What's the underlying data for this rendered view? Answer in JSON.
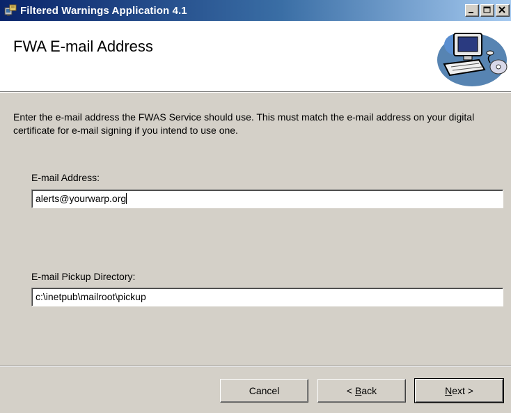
{
  "window": {
    "title": "Filtered Warnings Application 4.1",
    "controls": [
      "minimize-icon",
      "maximize-icon",
      "close-icon"
    ]
  },
  "header": {
    "title": "FWA E-mail Address",
    "art_icon": "computer-icon"
  },
  "instructions": "Enter the e-mail address the FWAS Service should use. This must match the e-mail address on your digital certificate for e-mail signing if you intend to use one.",
  "email": {
    "label": "E-mail Address:",
    "value": "alerts@yourwarp.org"
  },
  "pickup": {
    "label": "E-mail Pickup Directory:",
    "value": "c:\\inetpub\\mailroot\\pickup"
  },
  "buttons": {
    "cancel": "Cancel",
    "back_prefix": "< ",
    "back_key": "B",
    "back_rest": "ack",
    "next_key": "N",
    "next_rest": "ext >"
  },
  "colors": {
    "title_gradient_start": "#0a246a",
    "title_gradient_end": "#a6caf0",
    "dialog_face": "#d4d0c8",
    "header_bg": "#ffffff"
  }
}
